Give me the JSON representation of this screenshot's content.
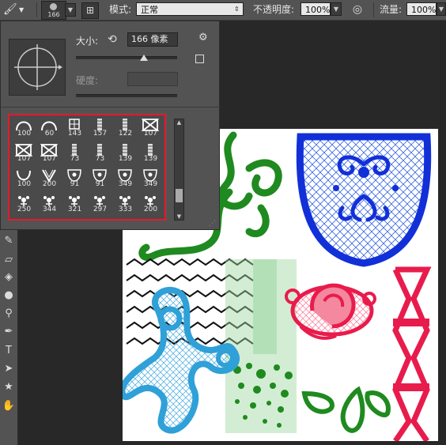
{
  "optionsBar": {
    "brushSize": "166",
    "modeLabel": "模式:",
    "modeValue": "正常",
    "opacityLabel": "不透明度:",
    "opacityValue": "100%",
    "flowLabel": "流量:",
    "flowValue": "100%"
  },
  "brushPanel": {
    "sizeLabel": "大小:",
    "sizeValue": "166 像素",
    "hardnessLabel": "硬度:",
    "presets": [
      {
        "size": "100",
        "icon": "arc-brush"
      },
      {
        "size": "60",
        "icon": "arc-brush"
      },
      {
        "size": "143",
        "icon": "lace-brush"
      },
      {
        "size": "157",
        "icon": "lace-strip-brush"
      },
      {
        "size": "122",
        "icon": "lace-strip-brush"
      },
      {
        "size": "107",
        "icon": "zigzag-brush"
      },
      {
        "size": "107",
        "icon": "zigzag-brush"
      },
      {
        "size": "107",
        "icon": "zigzag-brush"
      },
      {
        "size": "73",
        "icon": "lace-strip-brush"
      },
      {
        "size": "73",
        "icon": "lace-strip-brush"
      },
      {
        "size": "139",
        "icon": "lace-strip-brush"
      },
      {
        "size": "139",
        "icon": "lace-strip-brush"
      },
      {
        "size": "100",
        "icon": "cup-brush"
      },
      {
        "size": "200",
        "icon": "v-brush"
      },
      {
        "size": "91",
        "icon": "lace-shield-brush"
      },
      {
        "size": "91",
        "icon": "lace-shield-brush"
      },
      {
        "size": "349",
        "icon": "lace-shield-brush"
      },
      {
        "size": "349",
        "icon": "lace-shield-brush"
      },
      {
        "size": "250",
        "icon": "floral-brush"
      },
      {
        "size": "344",
        "icon": "floral-brush"
      },
      {
        "size": "321",
        "icon": "floral-brush"
      },
      {
        "size": "297",
        "icon": "floral-brush"
      },
      {
        "size": "333",
        "icon": "floral-brush"
      },
      {
        "size": "200",
        "icon": "floral-brush"
      }
    ]
  },
  "colors": {
    "accent": "#e8182c",
    "green": "#1f8a1f",
    "blue": "#1230d8",
    "cyan": "#2fa0d8",
    "pink": "#e81c4c"
  }
}
